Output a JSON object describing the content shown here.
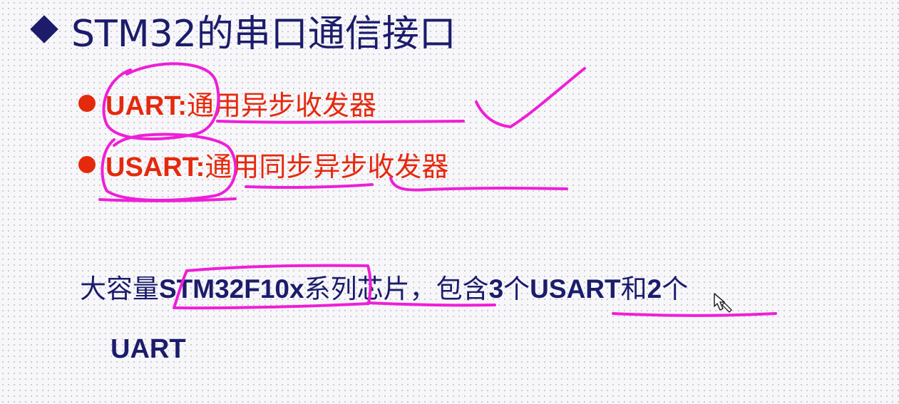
{
  "title": {
    "text": "STM32的串口通信接口"
  },
  "bullets": [
    {
      "term": "UART:",
      "desc": "通用异步收发器"
    },
    {
      "term": "USART:",
      "desc": "通用同步异步收发器"
    }
  ],
  "paragraph": {
    "seg1": "大容量",
    "chip": "STM32F10x",
    "seg2": "系列芯片，包含",
    "count1": "3",
    "seg3": "个",
    "type1": "USART",
    "seg4": "和",
    "count2": "2",
    "seg5": "个",
    "type2": "UART"
  },
  "colors": {
    "title": "#1c1c6b",
    "bullet_text": "#e5290c",
    "annotation_ink": "#ee1fd6"
  },
  "icons": {
    "bullet_marker": "diamond-icon",
    "list_marker": "dot-icon",
    "cursor": "hand-cursor-icon"
  }
}
